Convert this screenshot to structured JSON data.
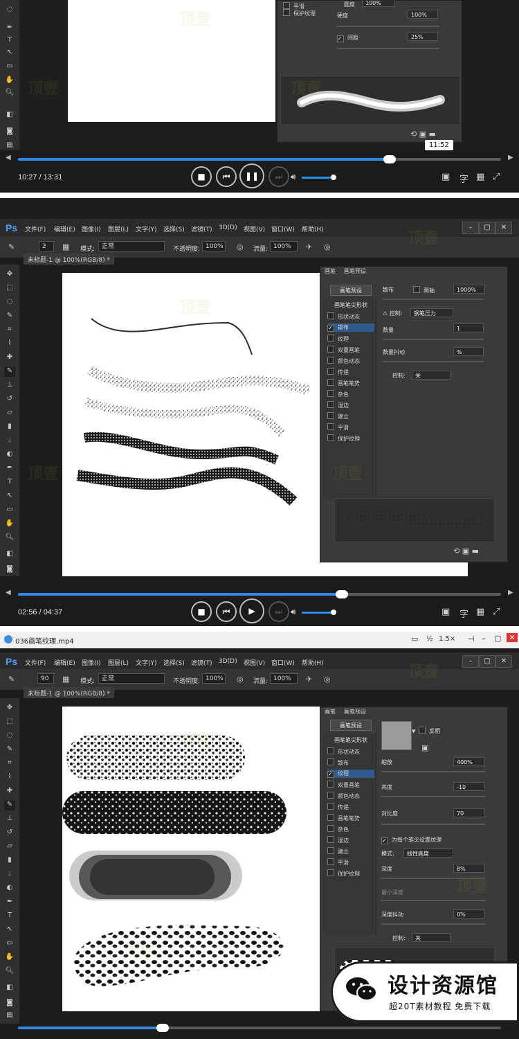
{
  "screen1": {
    "time": "10:27 / 13:31",
    "progress": 0.77,
    "tooltip": "11:52",
    "panel_rows": [
      {
        "label": "平滑",
        "value": ""
      },
      {
        "label": "保护纹理",
        "value": ""
      }
    ],
    "fields": [
      {
        "label": "圆度",
        "value": "100%"
      },
      {
        "label": "硬度",
        "value": "100%"
      },
      {
        "label": "间距",
        "value": "25%"
      }
    ]
  },
  "screen2": {
    "time": "02:56 / 04:37",
    "progress": 0.64,
    "menu": [
      "文件(F)",
      "编辑(E)",
      "图像(I)",
      "图层(L)",
      "文字(Y)",
      "选择(S)",
      "滤镜(T)",
      "3D(D)",
      "视图(V)",
      "窗口(W)",
      "帮助(H)"
    ],
    "options": {
      "brush_size": "2",
      "mode_label": "模式:",
      "mode_value": "正常",
      "opacity_label": "不透明度:",
      "opacity_value": "100%",
      "flow_label": "流量:",
      "flow_value": "100%"
    },
    "doc_tab": "未标题-1 @ 100%(RGB/8) *",
    "panel_tabs": [
      "画笔",
      "画笔预设"
    ],
    "preset_button": "画笔预设",
    "list_head": "画笔笔尖形状",
    "list": [
      "形状动态",
      "散布",
      "纹理",
      "双重画笔",
      "颜色动态",
      "传递",
      "画笔笔势",
      "杂色",
      "湿边",
      "建立",
      "平滑",
      "保护纹理"
    ],
    "scatter_label": "散布",
    "both_axes": "两轴",
    "scatter_value": "1000%",
    "control_label": "控制:",
    "control_value": "钢笔压力",
    "count_label": "数量",
    "count_value": "1",
    "count_jitter_label": "数量抖动",
    "count_jitter_value": "%",
    "control2_label": "控制:",
    "control2_value": "关"
  },
  "screen3": {
    "file_title": "036画笔纹理.mp4",
    "title_controls": [
      "½",
      "1.5×"
    ],
    "menu": [
      "文件(F)",
      "编辑(E)",
      "图像(I)",
      "图层(L)",
      "文字(Y)",
      "选择(S)",
      "滤镜(T)",
      "3D(D)",
      "视图(V)",
      "窗口(W)",
      "帮助(H)"
    ],
    "options": {
      "brush_size": "90",
      "mode_label": "模式:",
      "mode_value": "正常",
      "opacity_label": "不透明度:",
      "opacity_value": "100%",
      "flow_label": "流量:",
      "flow_value": "100%"
    },
    "doc_tab": "未标题-1 @ 100%(RGB/8) *",
    "panel_tabs": [
      "画笔",
      "画笔预设"
    ],
    "preset_button": "画笔预设",
    "list_head": "画笔笔尖形状",
    "list": [
      "形状动态",
      "散布",
      "纹理",
      "双重画笔",
      "颜色动态",
      "传递",
      "画笔笔势",
      "杂色",
      "湿边",
      "建立",
      "平滑",
      "保护纹理"
    ],
    "invert_label": "反相",
    "scale_label": "缩放",
    "scale_value": "400%",
    "brightness_label": "亮度",
    "brightness_value": "-10",
    "contrast_label": "对比度",
    "contrast_value": "70",
    "per_tip_label": "为每个笔尖设置纹理",
    "mode_label": "模式:",
    "mode_value": "线性高度",
    "depth_label": "深度",
    "depth_value": "8%",
    "min_depth_label": "最小深度",
    "depth_jitter_label": "深度抖动",
    "depth_jitter_value": "0%",
    "control_label": "控制:",
    "control_value": "关",
    "progress": 0.3
  },
  "brand": {
    "title": "设计资源馆",
    "subtitle": "超20T素材教程 免费下载"
  },
  "watermark_text": "顶壹",
  "colors": {
    "accent": "#2d8ae6",
    "ps_logo": "#4aa3ff",
    "panel_bg": "#3a3a3a"
  }
}
